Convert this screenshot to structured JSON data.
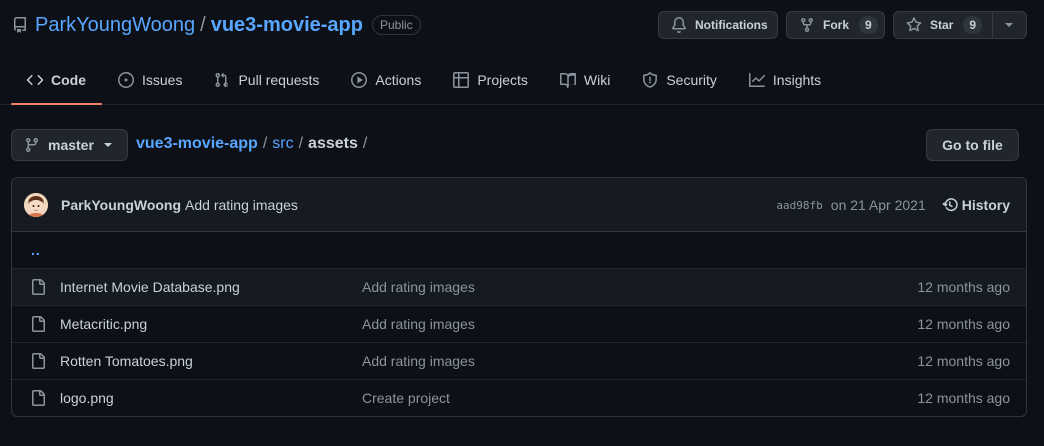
{
  "repo": {
    "owner": "ParkYoungWoong",
    "separator": "/",
    "name": "vue3-movie-app",
    "visibility": "Public"
  },
  "actions": {
    "notifications_label": "Notifications",
    "fork_label": "Fork",
    "fork_count": "9",
    "star_label": "Star",
    "star_count": "9"
  },
  "tabs": [
    {
      "label": "Code",
      "icon": "code-icon",
      "selected": true
    },
    {
      "label": "Issues",
      "icon": "issue-icon"
    },
    {
      "label": "Pull requests",
      "icon": "pull-request-icon"
    },
    {
      "label": "Actions",
      "icon": "play-icon"
    },
    {
      "label": "Projects",
      "icon": "table-icon"
    },
    {
      "label": "Wiki",
      "icon": "book-icon"
    },
    {
      "label": "Security",
      "icon": "shield-icon"
    },
    {
      "label": "Insights",
      "icon": "graph-icon"
    }
  ],
  "file_nav": {
    "branch": "master",
    "breadcrumb": {
      "repo": "vue3-movie-app",
      "sep": "/",
      "folder": "src",
      "current": "assets",
      "trailing_sep": "/"
    },
    "go_to_file_label": "Go to file"
  },
  "latest_commit": {
    "author": "ParkYoungWoong",
    "message": "Add rating images",
    "sha": "aad98fb",
    "date": "on 21 Apr 2021",
    "history_label": "History"
  },
  "parent_dir": "..",
  "files": [
    {
      "name": "Internet Movie Database.png",
      "commit": "Add rating images",
      "age": "12 months ago"
    },
    {
      "name": "Metacritic.png",
      "commit": "Add rating images",
      "age": "12 months ago"
    },
    {
      "name": "Rotten Tomatoes.png",
      "commit": "Add rating images",
      "age": "12 months ago"
    },
    {
      "name": "logo.png",
      "commit": "Create project",
      "age": "12 months ago"
    }
  ],
  "colors": {
    "background": "#0d1117",
    "link": "#58a6ff",
    "text": "#c9d1d9",
    "muted": "#8b949e",
    "tab_underline": "#f78166"
  }
}
